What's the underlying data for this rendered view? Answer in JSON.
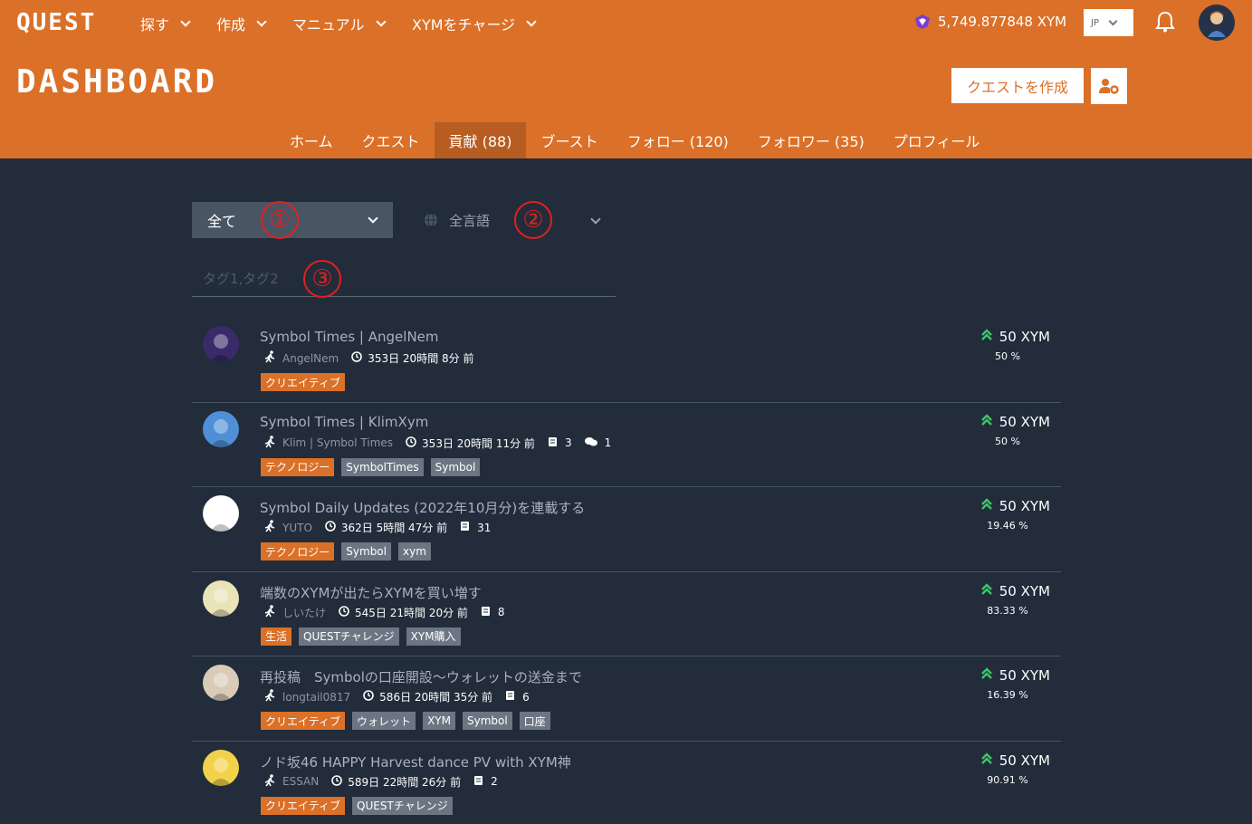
{
  "header": {
    "logo": "QUEST",
    "nav": [
      "探す",
      "作成",
      "マニュアル",
      "XYMをチャージ"
    ],
    "balance": "5,749.877848 XYM",
    "language": "JP",
    "page_title": "DASHBOARD",
    "create_quest_label": "クエストを作成"
  },
  "tabs": [
    "ホーム",
    "クエスト",
    "貢献 (88)",
    "ブースト",
    "フォロー (120)",
    "フォロワー (35)",
    "プロフィール"
  ],
  "filters": {
    "type_value": "全て",
    "language_value": "全言語",
    "tag_placeholder": "タグ1,タグ2",
    "markers": [
      "①",
      "②",
      "③"
    ]
  },
  "items": [
    {
      "title": "Symbol Times | AngelNem",
      "author": "AngelNem",
      "time": "353日 20時間 8分 前",
      "docs": "",
      "comments": "",
      "tags": [
        {
          "label": "クリエイティブ",
          "kind": "category"
        }
      ],
      "reward": "50 XYM",
      "percent": "50 %",
      "avatar_color": "#3a2a6a"
    },
    {
      "title": "Symbol Times | KlimXym",
      "author": "Klim | Symbol Times",
      "time": "353日 20時間 11分 前",
      "docs": "3",
      "comments": "1",
      "tags": [
        {
          "label": "テクノロジー",
          "kind": "category"
        },
        {
          "label": "SymbolTimes",
          "kind": "tag"
        },
        {
          "label": "Symbol",
          "kind": "tag"
        }
      ],
      "reward": "50 XYM",
      "percent": "50 %",
      "avatar_color": "#4f8fd6"
    },
    {
      "title": "Symbol Daily Updates (2022年10月分)を連載する",
      "author": "YUTO",
      "time": "362日 5時間 47分 前",
      "docs": "31",
      "comments": "",
      "tags": [
        {
          "label": "テクノロジー",
          "kind": "category"
        },
        {
          "label": "Symbol",
          "kind": "tag"
        },
        {
          "label": "xym",
          "kind": "tag"
        }
      ],
      "reward": "50 XYM",
      "percent": "19.46 %",
      "avatar_color": "#ffffff"
    },
    {
      "title": "端数のXYMが出たらXYMを買い増す",
      "author": "しいたけ",
      "time": "545日 21時間 20分 前",
      "docs": "8",
      "comments": "",
      "tags": [
        {
          "label": "生活",
          "kind": "category"
        },
        {
          "label": "QUESTチャレンジ",
          "kind": "tag"
        },
        {
          "label": "XYM購入",
          "kind": "tag"
        }
      ],
      "reward": "50 XYM",
      "percent": "83.33 %",
      "avatar_color": "#e8e4b8"
    },
    {
      "title": "再投稿　Symbolの口座開設～ウォレットの送金まで",
      "author": "longtail0817",
      "time": "586日 20時間 35分 前",
      "docs": "6",
      "comments": "",
      "tags": [
        {
          "label": "クリエイティブ",
          "kind": "category"
        },
        {
          "label": "ウォレット",
          "kind": "tag"
        },
        {
          "label": "XYM",
          "kind": "tag"
        },
        {
          "label": "Symbol",
          "kind": "tag"
        },
        {
          "label": "口座",
          "kind": "tag"
        }
      ],
      "reward": "50 XYM",
      "percent": "16.39 %",
      "avatar_color": "#d9cbb8"
    },
    {
      "title": "ノド坂46 HAPPY Harvest dance PV with XYM神",
      "author": "ESSAN",
      "time": "589日 22時間 26分 前",
      "docs": "2",
      "comments": "",
      "tags": [
        {
          "label": "クリエイティブ",
          "kind": "category"
        },
        {
          "label": "QUESTチャレンジ",
          "kind": "tag"
        }
      ],
      "reward": "50 XYM",
      "percent": "90.91 %",
      "avatar_color": "#f2d24a"
    }
  ],
  "colors": {
    "brand_orange": "#db7028",
    "background": "#222c3a",
    "boost_green": "#3ec46d"
  }
}
